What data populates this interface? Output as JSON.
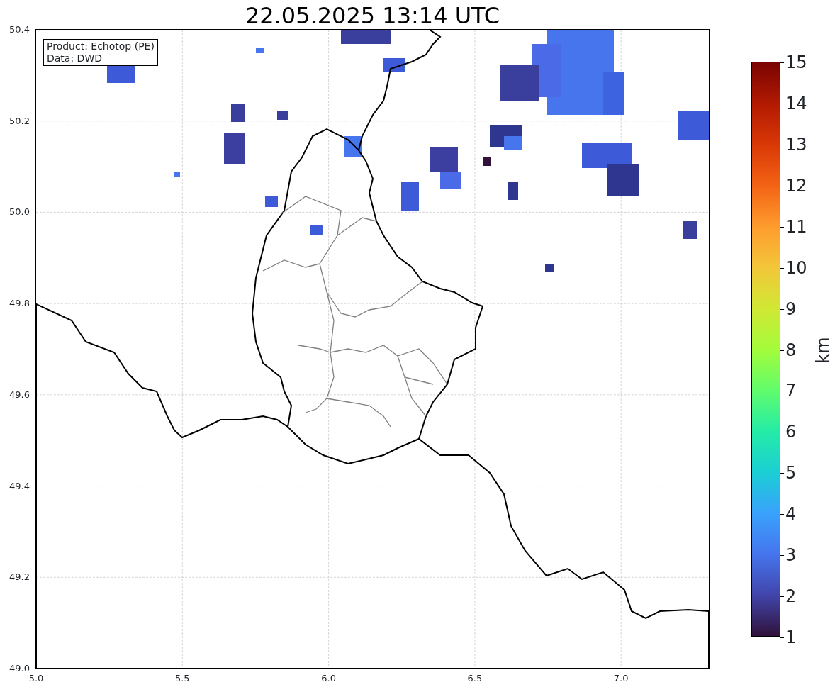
{
  "title": "22.05.2025 13:14 UTC",
  "legend": [
    "Product: Echotop (PE)",
    "Data: DWD"
  ],
  "y_ticks": [
    "50.4",
    "50.2",
    "50.0",
    "49.8",
    "49.6",
    "49.4",
    "49.2",
    "49.0"
  ],
  "x_ticks": [
    "5.0",
    "5.5",
    "6.0",
    "6.5",
    "7.0"
  ],
  "colorbar": {
    "label": "km",
    "ticks": [
      "15",
      "14",
      "13",
      "12",
      "11",
      "10",
      "9",
      "8",
      "7",
      "6",
      "5",
      "4",
      "3",
      "2",
      "1"
    ]
  }
}
